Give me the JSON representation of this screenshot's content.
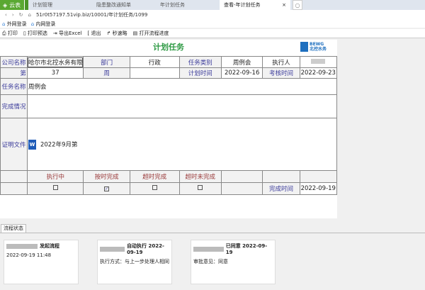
{
  "browser": {
    "home_tab": "云表",
    "tabs": [
      "计划管理",
      "隐患整改通知单",
      "年计划任务"
    ],
    "active_tab": "查看-年计划任务",
    "close": "×",
    "url": "51r0t57197.51vip.biz/10001/年计划任务/1099"
  },
  "bookmarks": [
    "外网登录",
    "内网登录"
  ],
  "toolbar": [
    "打印",
    "打印预选",
    "导出Excel",
    "退出",
    "秒速略",
    "打开流程进度"
  ],
  "form": {
    "title": "计划任务",
    "logo": "BEWG 北控水务",
    "company_label": "公司名称",
    "company": "哈尔市北控水务有限",
    "dept_label": "部门",
    "dept": "行政",
    "type_label": "任务类别",
    "type": "周例会",
    "executor_label": "执行人",
    "week_label": "第",
    "week": "37",
    "week_unit": "周",
    "plan_time_label": "计划时间",
    "plan_time": "2022-09-16",
    "check_time_label": "考核时间",
    "check_time": "2022-09-23",
    "task_name_label": "任务名称",
    "task_name": "周例会",
    "completion_label": "完成情况",
    "proof_label": "证明文件",
    "proof_file": "2022年9月第",
    "status_labels": [
      "执行中",
      "按时完成",
      "超时完成",
      "超时未完成"
    ],
    "status_checked": [
      false,
      true,
      false,
      false
    ],
    "done_time_label": "完成时间",
    "done_time": "2022-09-19"
  },
  "flow": {
    "tab": "流程状态",
    "cards": [
      {
        "title": "发起流程",
        "body": "2022-09-19 11:48"
      },
      {
        "title": "自动执行 2022-09-19",
        "body": "执行方式：与上一步处理人相同"
      },
      {
        "title": "已同意 2022-09-19",
        "body": "审批意见：同意"
      }
    ]
  }
}
